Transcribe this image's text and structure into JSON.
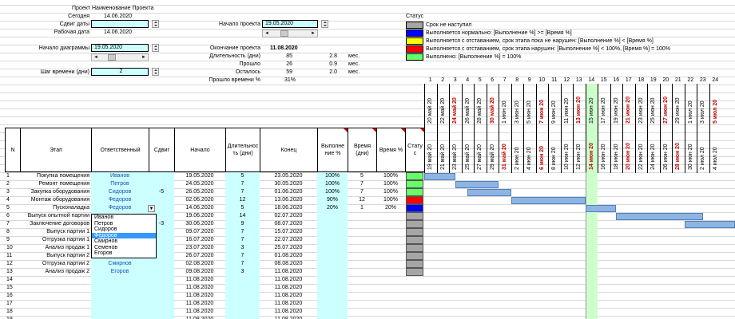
{
  "info": {
    "project_label": "Проект",
    "project_name": "Наименование Проекта",
    "today_label": "Сегодня",
    "today": "14.06.2020",
    "shift_label": "Сдвиг даты",
    "work_date_label": "Рабочая дата",
    "work_date": "14.06.2020",
    "chart_start_label": "Начало диаграммы",
    "chart_start": "19.05.2020",
    "step_label": "Шаг времени (дни)",
    "step": "2",
    "proj_start_label": "Начало проекта",
    "proj_start": "19.05.2020",
    "proj_end_label": "Окончание проекта",
    "proj_end": "11.08.2020",
    "dur_label": "Длительность (дни)",
    "dur_days": "85",
    "dur_mes": "2.8",
    "passed_label": "Прошло",
    "passed_days": "26",
    "passed_mes": "0.9",
    "left_label": "Осталось",
    "left_days": "59",
    "left_mes": "2.0",
    "mes": "мес.",
    "time_pct_label": "Прошло времени %",
    "time_pct": "31%"
  },
  "legend": {
    "title": "Статус",
    "items": [
      {
        "color": "#a6a6a6",
        "text": "Срок не наступил"
      },
      {
        "color": "#0000ff",
        "text": "Выполняется нормально: [Выполнение %] >= [Время %]"
      },
      {
        "color": "#ffff00",
        "text": "Выполняется с отставанием, срок этапа пока не нарушен: [Выполнение %] < [Время %]"
      },
      {
        "color": "#ff0000",
        "text": "Выполняется с отставанием, срок этапа нарушен: [Выполнение %] < 100%, [Время %] = 100%"
      },
      {
        "color": "#66ff66",
        "text": "Выполнено: [Выполнение %] = 100%"
      }
    ]
  },
  "headers": {
    "n": "N",
    "stage": "Этап",
    "resp": "Ответственный",
    "shift": "Сдвиг",
    "start": "Начало",
    "dur": "Длительнос ть (дни)",
    "end": "Конец",
    "done": "Выполне ние %",
    "time_days": "Время (дни)",
    "time_pct": "Время %",
    "status": "Стату с"
  },
  "day_numbers": [
    "1",
    "2",
    "3",
    "4",
    "5",
    "6",
    "7",
    "8",
    "9",
    "10",
    "11",
    "12",
    "13",
    "14",
    "15",
    "16",
    "17",
    "18",
    "19",
    "20",
    "21",
    "22",
    "23",
    "24"
  ],
  "dates_top": [
    "20 май 20",
    "22 май 20",
    "24 май 20",
    "26 май 20",
    "28 май 20",
    "30 май 20",
    "1 июн 20",
    "3 июн 20",
    "5 июн 20",
    "7 июн 20",
    "9 июн 20",
    "11 июн 20",
    "13 июн 20",
    "15 июн 20",
    "17 июн 20",
    "19 июн 20",
    "21 июн 20",
    "23 июн 20",
    "25 июн 20",
    "27 июн 20",
    "29 июн 20",
    "1 июл 20",
    "3 июл 20",
    "5 июл 20"
  ],
  "dates_bottom": [
    "19 май 20",
    "21 май 20",
    "23 май 20",
    "25 май 20",
    "27 май 20",
    "29 май 20",
    "31 май 20",
    "2 июн 20",
    "4 июн 20",
    "6 июн 20",
    "8 июн 20",
    "10 июн 20",
    "12 июн 20",
    "14 июн 20",
    "16 июн 20",
    "18 июн 20",
    "20 июн 20",
    "22 июн 20",
    "24 июн 20",
    "26 июн 20",
    "28 июн 20",
    "30 июн 20",
    "2 июл 20",
    "4 июл 20"
  ],
  "rows": [
    {
      "n": "1",
      "stage": "Покупка помещения",
      "resp": "Иванов",
      "shift": "",
      "start": "19.05.2020",
      "dur": "5",
      "end": "23.05.2020",
      "done": "100%",
      "tdays": "5",
      "tpct": "100%",
      "status": "#66ff66"
    },
    {
      "n": "2",
      "stage": "Ремонт помещения",
      "resp": "Петров",
      "shift": "",
      "start": "24.05.2020",
      "dur": "7",
      "end": "30.05.2020",
      "done": "100%",
      "tdays": "7",
      "tpct": "100%",
      "status": "#66ff66"
    },
    {
      "n": "3",
      "stage": "Закупка оборудования",
      "resp": "Сидоров",
      "shift": "-5",
      "start": "26.05.2020",
      "dur": "7",
      "end": "01.06.2020",
      "done": "100%",
      "tdays": "7",
      "tpct": "100%",
      "status": "#66ff66"
    },
    {
      "n": "4",
      "stage": "Монтаж оборудования",
      "resp": "Федоров",
      "shift": "",
      "start": "02.06.2020",
      "dur": "12",
      "end": "13.06.2020",
      "done": "90%",
      "tdays": "12",
      "tpct": "100%",
      "status": "#ff0000"
    },
    {
      "n": "5",
      "stage": "Пусконаладка",
      "resp": "Федоров",
      "shift": "",
      "start": "14.06.2020",
      "dur": "5",
      "end": "18.06.2020",
      "done": "20%",
      "tdays": "1",
      "tpct": "20%",
      "status": "#0000ff"
    },
    {
      "n": "6",
      "stage": "Выпуск опытной партии",
      "resp": "",
      "shift": "",
      "start": "19.06.2020",
      "dur": "14",
      "end": "02.07.2020",
      "done": "",
      "tdays": "",
      "tpct": "",
      "status": "#a6a6a6"
    },
    {
      "n": "7",
      "stage": "Заключение договоров",
      "resp": "",
      "shift": "-3",
      "start": "30.06.2020",
      "dur": "9",
      "end": "08.07.2020",
      "done": "",
      "tdays": "",
      "tpct": "",
      "status": "#a6a6a6"
    },
    {
      "n": "8",
      "stage": "Выпуск партии 1",
      "resp": "",
      "shift": "",
      "start": "09.07.2020",
      "dur": "7",
      "end": "15.07.2020",
      "done": "",
      "tdays": "",
      "tpct": "",
      "status": "#a6a6a6"
    },
    {
      "n": "9",
      "stage": "Отгрузка партии 1",
      "resp": "",
      "shift": "",
      "start": "16.07.2020",
      "dur": "7",
      "end": "22.07.2020",
      "done": "",
      "tdays": "",
      "tpct": "",
      "status": "#a6a6a6"
    },
    {
      "n": "10",
      "stage": "Анализ продаж 1",
      "resp": "",
      "shift": "",
      "start": "23.07.2020",
      "dur": "3",
      "end": "25.07.2020",
      "done": "",
      "tdays": "",
      "tpct": "",
      "status": "#a6a6a6"
    },
    {
      "n": "11",
      "stage": "Выпуск партии 2",
      "resp": "",
      "shift": "",
      "start": "26.07.2020",
      "dur": "7",
      "end": "01.08.2020",
      "done": "",
      "tdays": "",
      "tpct": "",
      "status": "#a6a6a6"
    },
    {
      "n": "12",
      "stage": "Отгрузка партии 2",
      "resp": "Смирнов",
      "shift": "",
      "start": "02.08.2020",
      "dur": "7",
      "end": "08.08.2020",
      "done": "",
      "tdays": "",
      "tpct": "",
      "status": "#a6a6a6"
    },
    {
      "n": "13",
      "stage": "Анализ продаж 2",
      "resp": "Егоров",
      "shift": "",
      "start": "09.08.2020",
      "dur": "3",
      "end": "11.08.2020",
      "done": "",
      "tdays": "",
      "tpct": "",
      "status": "#a6a6a6"
    },
    {
      "n": "14",
      "stage": "",
      "resp": "",
      "shift": "",
      "start": "11.08.2020",
      "dur": "",
      "end": "11.08.2020",
      "done": "",
      "tdays": "",
      "tpct": "",
      "status": ""
    },
    {
      "n": "15",
      "stage": "",
      "resp": "",
      "shift": "",
      "start": "11.08.2020",
      "dur": "",
      "end": "11.08.2020",
      "done": "",
      "tdays": "",
      "tpct": "",
      "status": ""
    },
    {
      "n": "16",
      "stage": "",
      "resp": "",
      "shift": "",
      "start": "11.08.2020",
      "dur": "",
      "end": "11.08.2020",
      "done": "",
      "tdays": "",
      "tpct": "",
      "status": ""
    },
    {
      "n": "17",
      "stage": "",
      "resp": "",
      "shift": "",
      "start": "11.08.2020",
      "dur": "",
      "end": "11.08.2020",
      "done": "",
      "tdays": "",
      "tpct": "",
      "status": ""
    },
    {
      "n": "18",
      "stage": "",
      "resp": "",
      "shift": "",
      "start": "11.08.2020",
      "dur": "",
      "end": "11.08.2020",
      "done": "",
      "tdays": "",
      "tpct": "",
      "status": ""
    },
    {
      "n": "19",
      "stage": "",
      "resp": "",
      "shift": "",
      "start": "11.08.2020",
      "dur": "",
      "end": "11.08.2020",
      "done": "",
      "tdays": "",
      "tpct": "",
      "status": ""
    }
  ],
  "dropdown": {
    "options": [
      "Иванов",
      "Петров",
      "Сидоров",
      "Федоров",
      "Смирнов",
      "Семенов",
      "Егоров"
    ],
    "selected": "Федоров"
  },
  "gantt": {
    "first_date": "19.05.2020",
    "days_per_col": 2,
    "today": "14.06.2020"
  },
  "colors": {
    "input_bg": "#ccffff",
    "bar": "#8eb4e3",
    "today_col": "#ccffcc",
    "weekend": "#c00000"
  }
}
